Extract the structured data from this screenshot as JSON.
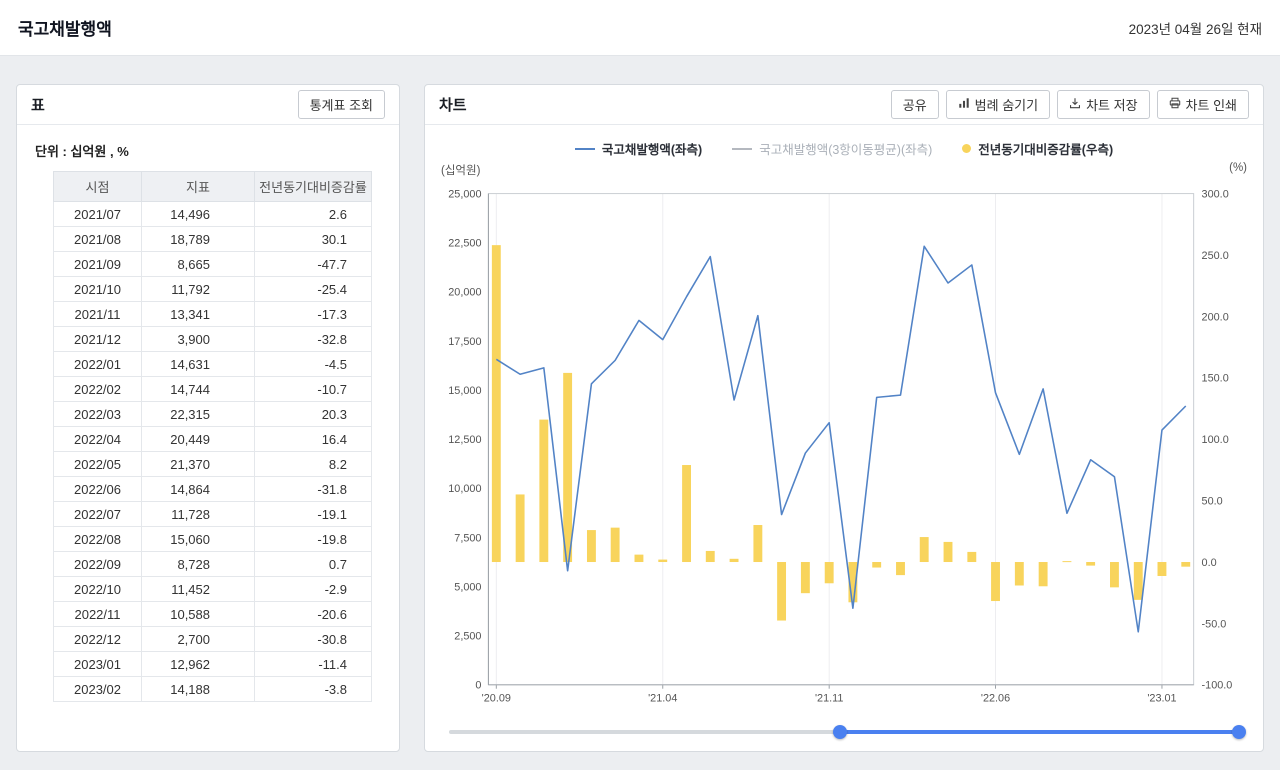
{
  "page": {
    "title": "국고채발행액",
    "as_of_date": "2023년 04월 26일 현재"
  },
  "table_panel": {
    "title": "표",
    "view_button_label": "통계표 조회",
    "unit_label": "단위 : 십억원 , %",
    "columns": [
      "시점",
      "지표",
      "전년동기대비증감률"
    ],
    "rows": [
      {
        "period": "2021/07",
        "value": "14,496",
        "yoy": "2.6"
      },
      {
        "period": "2021/08",
        "value": "18,789",
        "yoy": "30.1"
      },
      {
        "period": "2021/09",
        "value": "8,665",
        "yoy": "-47.7"
      },
      {
        "period": "2021/10",
        "value": "11,792",
        "yoy": "-25.4"
      },
      {
        "period": "2021/11",
        "value": "13,341",
        "yoy": "-17.3"
      },
      {
        "period": "2021/12",
        "value": "3,900",
        "yoy": "-32.8"
      },
      {
        "period": "2022/01",
        "value": "14,631",
        "yoy": "-4.5"
      },
      {
        "period": "2022/02",
        "value": "14,744",
        "yoy": "-10.7"
      },
      {
        "period": "2022/03",
        "value": "22,315",
        "yoy": "20.3"
      },
      {
        "period": "2022/04",
        "value": "20,449",
        "yoy": "16.4"
      },
      {
        "period": "2022/05",
        "value": "21,370",
        "yoy": "8.2"
      },
      {
        "period": "2022/06",
        "value": "14,864",
        "yoy": "-31.8"
      },
      {
        "period": "2022/07",
        "value": "11,728",
        "yoy": "-19.1"
      },
      {
        "period": "2022/08",
        "value": "15,060",
        "yoy": "-19.8"
      },
      {
        "period": "2022/09",
        "value": "8,728",
        "yoy": "0.7"
      },
      {
        "period": "2022/10",
        "value": "11,452",
        "yoy": "-2.9"
      },
      {
        "period": "2022/11",
        "value": "10,588",
        "yoy": "-20.6"
      },
      {
        "period": "2022/12",
        "value": "2,700",
        "yoy": "-30.8"
      },
      {
        "period": "2023/01",
        "value": "12,962",
        "yoy": "-11.4"
      },
      {
        "period": "2023/02",
        "value": "14,188",
        "yoy": "-3.8"
      }
    ]
  },
  "chart_panel": {
    "title": "차트",
    "share_button_label": "공유",
    "hide_legend_button_label": "범례 숨기기",
    "save_button_label": "차트 저장",
    "print_button_label": "차트 인쇄"
  },
  "chart_data": {
    "type": "combo",
    "x": [
      "2020/09",
      "2020/10",
      "2020/11",
      "2020/12",
      "2021/01",
      "2021/02",
      "2021/03",
      "2021/04",
      "2021/05",
      "2021/06",
      "2021/07",
      "2021/08",
      "2021/09",
      "2021/10",
      "2021/11",
      "2021/12",
      "2022/01",
      "2022/02",
      "2022/03",
      "2022/04",
      "2022/05",
      "2022/06",
      "2022/07",
      "2022/08",
      "2022/09",
      "2022/10",
      "2022/11",
      "2022/12",
      "2023/01",
      "2023/02"
    ],
    "x_tick_labels": [
      "'20.09",
      "'21.04",
      "'21.11",
      "'22.06",
      "'23.01"
    ],
    "x_tick_indices": [
      0,
      7,
      14,
      21,
      28
    ],
    "left_axis": {
      "label": "(십억원)",
      "min": 0,
      "max": 25000,
      "step": 2500,
      "tick_labels": [
        "0",
        "2,500",
        "5,000",
        "7,500",
        "10,000",
        "12,500",
        "15,000",
        "17,500",
        "20,000",
        "22,500",
        "25,000"
      ]
    },
    "right_axis": {
      "label": "(%)",
      "min": -100,
      "max": 300,
      "step": 50,
      "tick_labels": [
        "-100.0",
        "-50.0",
        "0.0",
        "50.0",
        "100.0",
        "150.0",
        "200.0",
        "250.0",
        "300.0"
      ]
    },
    "series": [
      {
        "name": "국고채발행액(좌측)",
        "type": "line",
        "axis": "left",
        "color": "#5283c6",
        "disabled": false,
        "values": [
          16568,
          15807,
          16132,
          5804,
          15320,
          16510,
          18549,
          17568,
          19751,
          21795,
          14496,
          18789,
          8665,
          11792,
          13341,
          3900,
          14631,
          14744,
          22315,
          20449,
          21370,
          14864,
          11728,
          15060,
          8728,
          11452,
          10588,
          2700,
          12962,
          14188
        ]
      },
      {
        "name": "국고채발행액(3항이동평균)(좌측)",
        "type": "line",
        "axis": "left",
        "color": "#b4b8bf",
        "disabled": true,
        "values": []
      },
      {
        "name": "전년동기대비증감률(우측)",
        "type": "bar",
        "axis": "right",
        "color": "#f8d45c",
        "disabled": false,
        "values": [
          258,
          55,
          116,
          154,
          26,
          28,
          6,
          2,
          79,
          9,
          2.6,
          30.1,
          -47.7,
          -25.4,
          -17.3,
          -32.8,
          -4.5,
          -10.7,
          20.3,
          16.4,
          8.2,
          -31.8,
          -19.1,
          -19.8,
          0.7,
          -2.9,
          -20.6,
          -30.8,
          -11.4,
          -3.8
        ]
      }
    ],
    "slider": {
      "start_pct": 49.5,
      "end_pct": 100
    }
  }
}
